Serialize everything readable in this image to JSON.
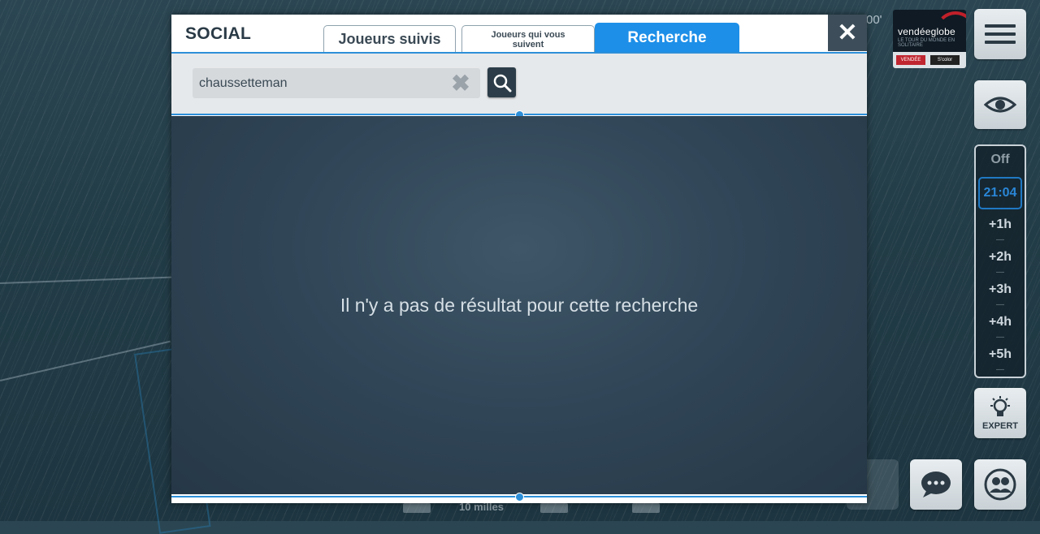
{
  "background": {
    "coord_fragment": "00'",
    "logo": {
      "name": "vendéeglobe",
      "sub": "LE TOUR DU MONDE EN SOLITAIRE",
      "chip_left": "VENDÉE",
      "chip_right": "S'color"
    },
    "scale_label": "10 milles"
  },
  "time_control": {
    "off_label": "Off",
    "current_time": "21:04",
    "steps": [
      "+1h",
      "+2h",
      "+3h",
      "+4h",
      "+5h"
    ]
  },
  "expert": {
    "label": "EXPERT"
  },
  "dialog": {
    "title": "SOCIAL",
    "tabs": [
      {
        "label": "Joueurs suivis",
        "active": false
      },
      {
        "label": "Joueurs qui vous suivent",
        "active": false
      },
      {
        "label": "Recherche",
        "active": true
      }
    ],
    "close_glyph": "✕",
    "search": {
      "value": "chaussetteman",
      "clear_glyph": "✖"
    },
    "empty_message": "Il n'y a pas de résultat pour cette recherche"
  },
  "colors": {
    "accent": "#1d8fe8",
    "dialog_dark": "#2e4354"
  }
}
